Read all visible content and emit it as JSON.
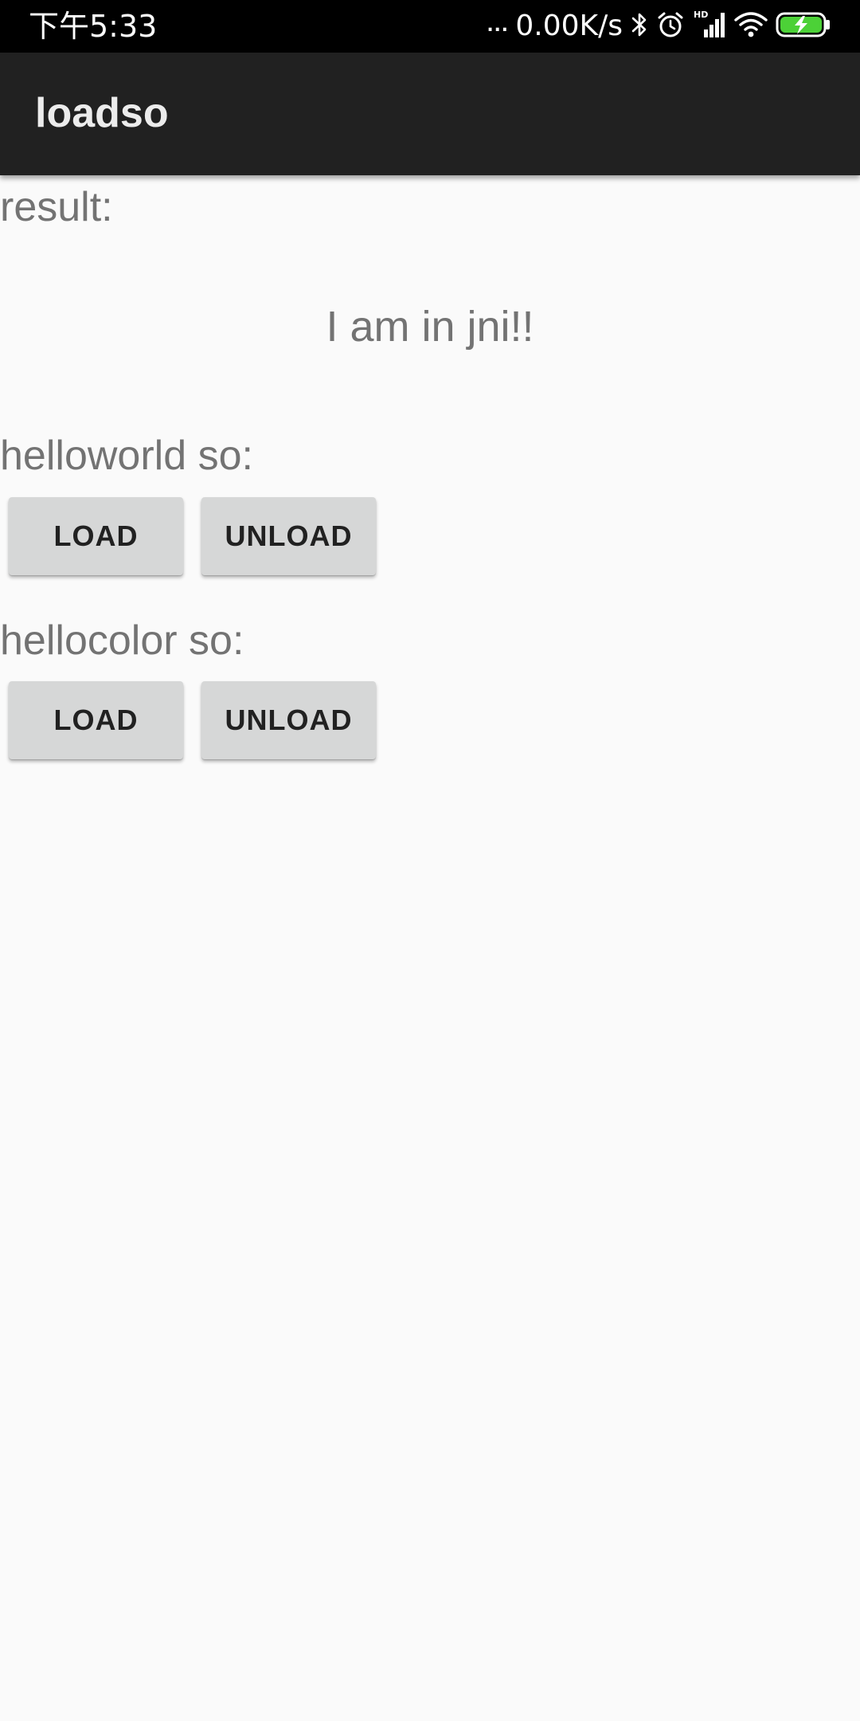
{
  "status_bar": {
    "time": "下午5:33",
    "network_speed": "0.00K/s",
    "more_indicator": "...",
    "icons": [
      "bluetooth-icon",
      "alarm-icon",
      "hd-signal-icon",
      "wifi-icon",
      "battery-charging-icon"
    ],
    "battery_color": "#4cd137"
  },
  "app_bar": {
    "title": "loadso",
    "background": "#212121"
  },
  "main": {
    "result_label": "result:",
    "result_text": "I am in jni!!",
    "sections": [
      {
        "label": "helloworld so:",
        "load_label": "LOAD",
        "unload_label": "UNLOAD"
      },
      {
        "label": "hellocolor so:",
        "load_label": "LOAD",
        "unload_label": "UNLOAD"
      }
    ]
  }
}
